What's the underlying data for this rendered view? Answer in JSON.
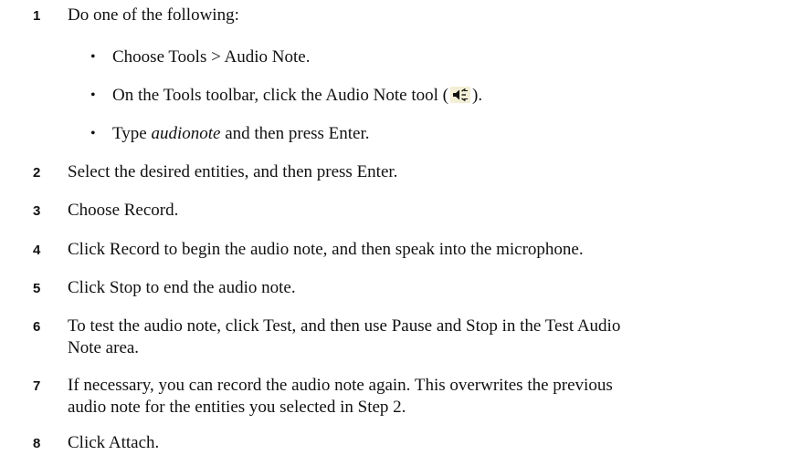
{
  "steps": [
    {
      "num": "1",
      "text": "Do one of the following:"
    },
    {
      "num": "2",
      "text": "Select the desired entities, and then press Enter."
    },
    {
      "num": "3",
      "text": "Choose Record."
    },
    {
      "num": "4",
      "text": "Click Record to begin the audio note, and then speak into the microphone."
    },
    {
      "num": "5",
      "text": "Click Stop to end the audio note."
    },
    {
      "num": "6",
      "line1": "To test the audio note, click Test, and then use Pause and Stop in the Test Audio",
      "line2": "Note area."
    },
    {
      "num": "7",
      "line1": "If necessary, you can record the audio note again. This overwrites the previous",
      "line2": "audio note for the entities you selected in Step 2."
    },
    {
      "num": "8",
      "text": "Click Attach."
    }
  ],
  "bullets": [
    {
      "text": "Choose Tools > Audio Note."
    },
    {
      "pre": "On the Tools toolbar, click the Audio Note tool (",
      "icon": "audio-note-icon",
      "post": ")."
    },
    {
      "pre": "Type ",
      "italic": "audionote",
      "post": " and then press Enter."
    }
  ],
  "bullet_char": "•"
}
